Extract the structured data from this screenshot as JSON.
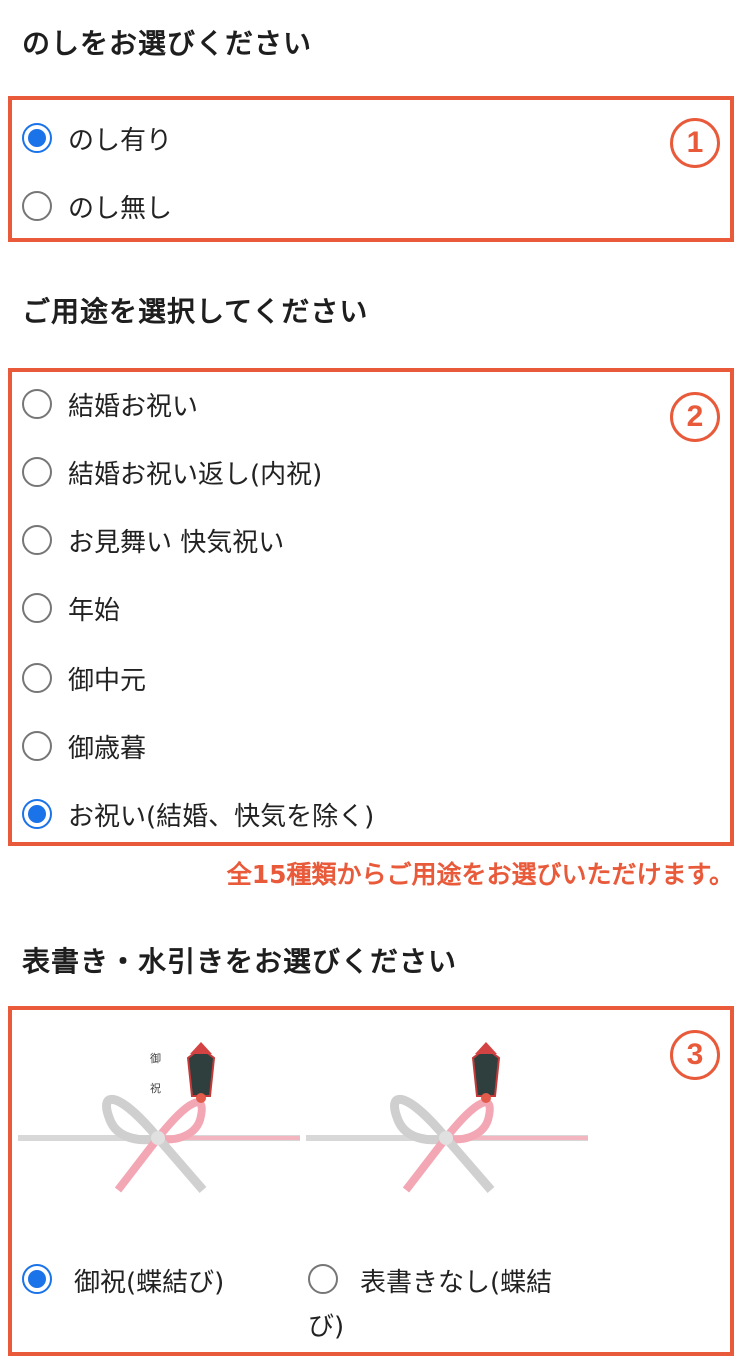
{
  "noshi_section": {
    "title": "のしをお選びください",
    "badge": "1",
    "options": [
      {
        "label": "のし有り",
        "checked": true
      },
      {
        "label": "のし無し",
        "checked": false
      }
    ]
  },
  "purpose_section": {
    "title": "ご用途を選択してください",
    "badge": "2",
    "options": [
      {
        "label": "結婚お祝い",
        "checked": false
      },
      {
        "label": "結婚お祝い返し(内祝)",
        "checked": false
      },
      {
        "label": "お見舞い 快気祝い",
        "checked": false
      },
      {
        "label": "年始",
        "checked": false
      },
      {
        "label": "御中元",
        "checked": false
      },
      {
        "label": "御歳暮",
        "checked": false
      },
      {
        "label": "お祝い(結婚、快気を除く)",
        "checked": true
      }
    ],
    "note": "全15種類からご用途をお選びいただけます。"
  },
  "style_section": {
    "title": "表書き・水引きをお選びください",
    "badge": "3",
    "options": [
      {
        "label": "御祝(蝶結び)",
        "checked": true,
        "icon": "noshi-gyoshuku-icon"
      },
      {
        "label_line1": "表書きなし(蝶結",
        "label_line2": "び)",
        "checked": false,
        "icon": "noshi-plain-icon"
      }
    ]
  },
  "colors": {
    "accent": "#e85a3a",
    "radio_checked": "#1a73e8",
    "radio_border": "#767676"
  }
}
